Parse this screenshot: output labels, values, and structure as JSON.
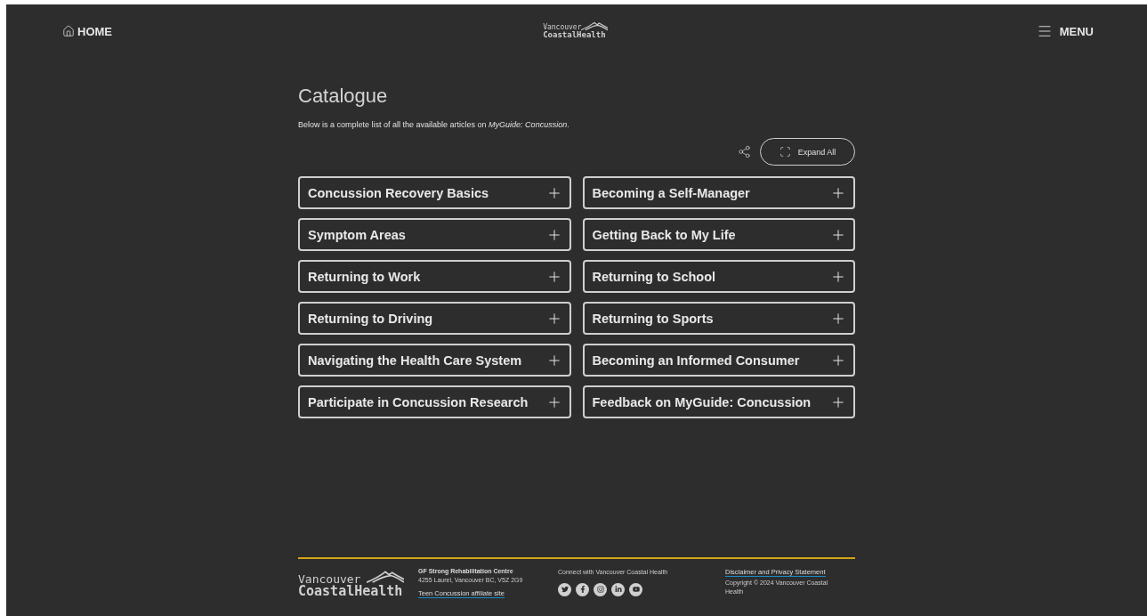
{
  "header": {
    "home": "HOME",
    "logo": {
      "line_1": "Vancouver",
      "line_2": "CoastalHealth"
    },
    "menu": "MENU"
  },
  "page": {
    "title": "Catalogue",
    "intro": "Below is a complete list of all the available articles on *MyGuide: Concussion*.",
    "expand_button": "Expand All"
  },
  "sections": [
    {
      "label": "Concussion Recovery Basics",
      "expanded": false
    },
    {
      "label": "Becoming a Self-Manager",
      "expanded": false
    },
    {
      "label": "Symptom Areas",
      "expanded": false
    },
    {
      "label": "Getting Back to My Life",
      "expanded": false
    },
    {
      "label": "Returning to Work",
      "expanded": false
    },
    {
      "label": "Returning to School",
      "expanded": false
    },
    {
      "label": "Returning to Driving",
      "expanded": false
    },
    {
      "label": "Returning to Sports",
      "expanded": false
    },
    {
      "label": "Navigating the Health Care System",
      "expanded": false
    },
    {
      "label": "Becoming an Informed Consumer",
      "expanded": false
    },
    {
      "label": "Participate in Concussion Research",
      "expanded": false
    },
    {
      "label": "Feedback on MyGuide: Concussion",
      "expanded": false
    }
  ],
  "footer": {
    "logo": {
      "line_1": "Vancouver",
      "line_2": "CoastalHealth"
    },
    "centre_name": "GF Strong Rehabilitation Centre",
    "address": "4255 Laurel, Vancouver BC, V5Z 2G9",
    "affiliate_link": "Teen Concussion affiliate site",
    "connect_label": "Connect with Vancouver Coastal Health",
    "disclaimer_link": "Disclaimer and Privacy Statement",
    "copyright": "Copyright © 2024 Vancouver Coastal Health"
  }
}
